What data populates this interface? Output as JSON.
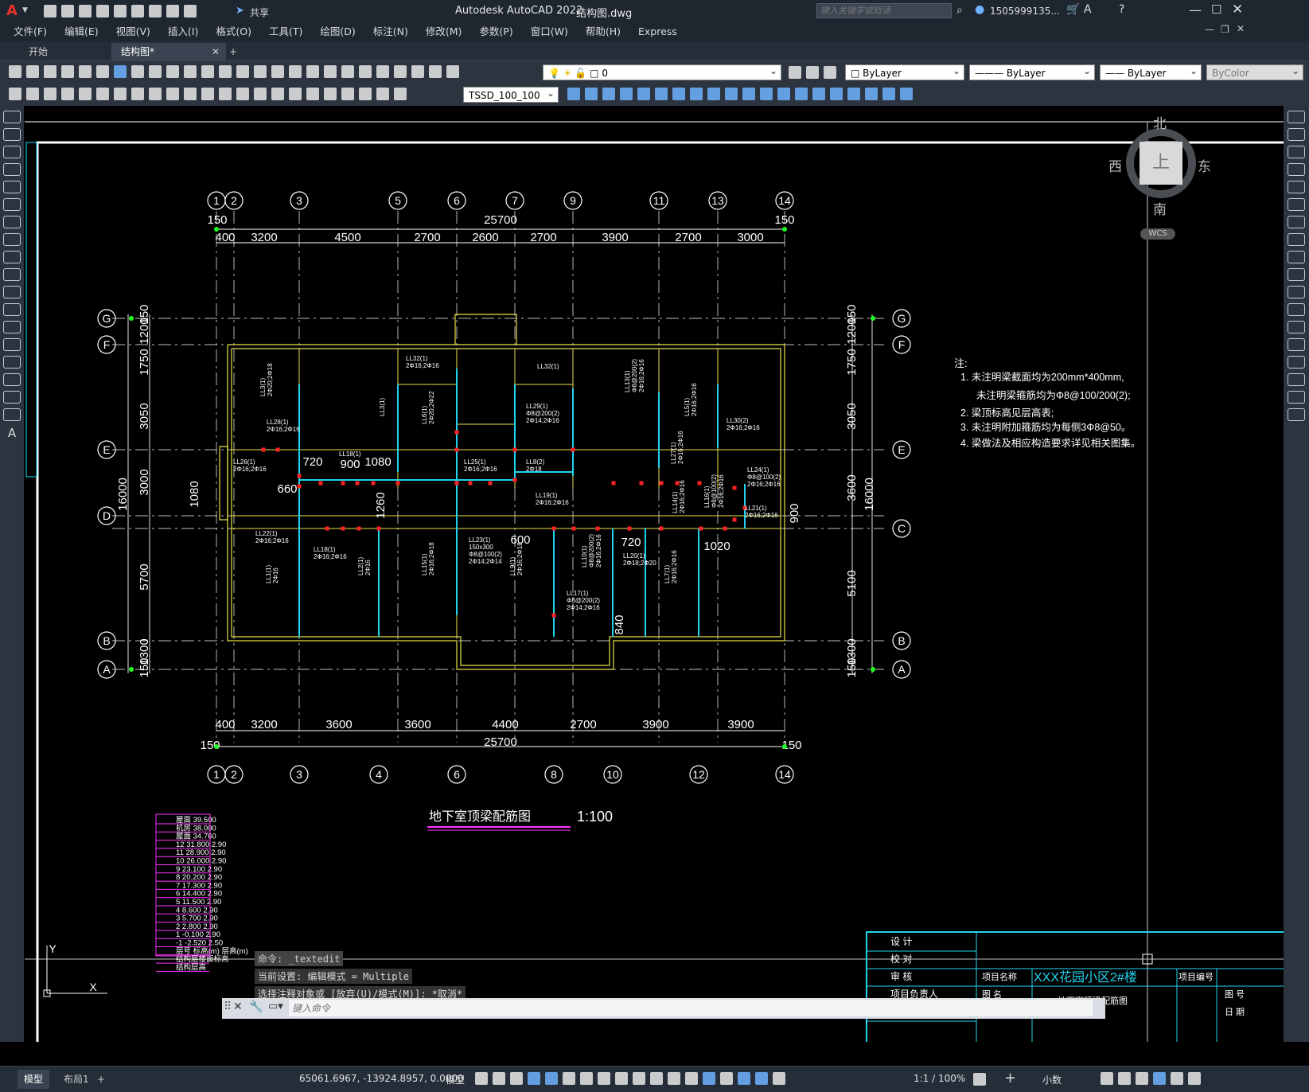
{
  "app": {
    "logo": "A",
    "title_app": "Autodesk AutoCAD 2022",
    "title_file": "结构图.dwg",
    "share": "共享",
    "search_placeholder": "键入关键字或短语",
    "user": "1505999135...",
    "window_controls": [
      "minimize-icon",
      "maximize-icon",
      "close-icon"
    ]
  },
  "menu": [
    "文件(F)",
    "编辑(E)",
    "视图(V)",
    "插入(I)",
    "格式(O)",
    "工具(T)",
    "绘图(D)",
    "标注(N)",
    "修改(M)",
    "参数(P)",
    "窗口(W)",
    "帮助(H)",
    "Express"
  ],
  "tabs": [
    {
      "label": "开始"
    },
    {
      "label": "结构图*"
    }
  ],
  "toolbar": {
    "layer_value": "0",
    "color_value": "ByLayer",
    "linetype_value": "ByLayer",
    "lineweight_value": "ByLayer",
    "plotstyle_value": "ByColor",
    "textstyle_value": "TSSD_100_100"
  },
  "viewcube": {
    "north": "北",
    "south": "南",
    "east": "东",
    "west": "西",
    "top": "上",
    "wcs": "WCS"
  },
  "drawing": {
    "top_axes": [
      "1",
      "2",
      "3",
      "5",
      "6",
      "7",
      "9",
      "11",
      "13",
      "14"
    ],
    "bottom_axes": [
      "1",
      "2",
      "3",
      "4",
      "6",
      "8",
      "10",
      "12",
      "14"
    ],
    "left_axes": [
      "G",
      "F",
      "E",
      "D",
      "B",
      "A"
    ],
    "right_axes": [
      "G",
      "F",
      "E",
      "C",
      "B",
      "A"
    ],
    "top_total": "25700",
    "top_edge": "150",
    "top_dims": [
      "400",
      "3200",
      "4500",
      "2700",
      "2600",
      "2700",
      "3900",
      "2700",
      "3000"
    ],
    "bottom_total": "25700",
    "bottom_edge": "150",
    "bottom_dims": [
      "400",
      "3200",
      "3600",
      "3600",
      "4400",
      "2700",
      "3900",
      "3900"
    ],
    "left_dims": [
      "150",
      "1200",
      "1750",
      "3050",
      "3000",
      "5700",
      "1300",
      "150"
    ],
    "left_total": "16000",
    "left_extra": "1080",
    "right_dims": [
      "150",
      "1200",
      "1750",
      "3050",
      "3600",
      "5100",
      "1300",
      "150"
    ],
    "right_total": "16000",
    "right_extra": "900",
    "inner_dims": [
      "720",
      "900",
      "1080",
      "660",
      "1260",
      "600",
      "720",
      "1020",
      "840",
      "900"
    ],
    "beam_labels": [
      "LL32(1)\n2Φ16;2Φ16",
      "LL32(1)",
      "LL3(1)\n2Φ20;2Φ18",
      "LL28(1)\n2Φ16;2Φ16",
      "LL3(1)",
      "LL6(1)\n2Φ20;2Φ22",
      "LL29(1)\nΦ8@200(2)\n2Φ14;2Φ16",
      "LL13(1)\nΦ8@200(2)\n2Φ16;2Φ16",
      "LL5(1)\n2Φ16;2Φ16",
      "LL30(2)\n2Φ16;2Φ16",
      "LL26(1)\n2Φ16;2Φ16",
      "LL18(1)",
      "LL25(1)\n2Φ16;2Φ16",
      "LL8(2)\n2Φ18",
      "LL27(1)\n2Φ16;2Φ16",
      "LL24(1)\nΦ8@100(2)\n2Φ16;2Φ16",
      "LL19(1)\n2Φ16;2Φ16",
      "LL14(1)\n2Φ16;2Φ16",
      "LL16(1)\nΦ8@100(2)\n2Φ16;2Φ16",
      "LL21(1)\n2Φ16;2Φ16",
      "LL22(1)\n2Φ16;2Φ16",
      "LL18(1)\n2Φ16;2Φ16",
      "LL23(1)\n150x300\nΦ8@100(2)\n2Φ14;2Φ14",
      "LL20(1)\n2Φ18;2Φ20",
      "LL2(1)\n2Φ16",
      "LL15(1)\n2Φ16;2Φ18",
      "LL9(1)\n2Φ16;2Φ18",
      "LL10(1)\nΦ8@200(2)\n2Φ16;2Φ16",
      "LL17(1)\nΦ8@200(2)\n2Φ14;2Φ16",
      "LL7(1)\n2Φ16;2Φ16",
      "LL1(1)\n2Φ16"
    ],
    "notes_title": "注:",
    "notes": [
      "1. 未注明梁截面均为200mm*400mm,",
      "未注明梁箍筋均为Φ8@100/200(2);",
      "2. 梁顶标高见层高表;",
      "3. 未注明附加箍筋均为每侧3Φ8@50。",
      "4. 梁做法及相应构造要求详见相关图集。"
    ],
    "drawing_title": "地下室顶梁配筋图",
    "scale": "1:100",
    "level_table": [
      "屋面  39.500",
      "机房  38.000",
      "屋面  34.760",
      "12  31.800  2.90",
      "11  28.900  2.90",
      "10  26.000  2.90",
      "9  23.100  2.90",
      "8  20.200  2.90",
      "7  17.300  2.90",
      "6  14.400  2.90",
      "5  11.500  2.90",
      "4  8.600  2.90",
      "3  5.700  2.90",
      "2  2.800  2.90",
      "1  -0.100  2.90",
      "-1  -2.520  2.50",
      "层号  标高(m)  层高(m)",
      "结构层楼面标高",
      "结构层高"
    ],
    "title_block": {
      "rows": [
        "设  计",
        "校  对",
        "审  核",
        "项目负责人",
        "专业负责人"
      ],
      "project_name_label": "项目名称",
      "project_name": "XXX花园小区2#楼",
      "project_no_label": "项目编号",
      "drawing_name_label": "图  名",
      "drawing_name": "地下室顶梁配筋图",
      "sheet_no_label": "图  号",
      "date_label": "日  期"
    },
    "ucs_x": "X",
    "ucs_y": "Y"
  },
  "command": {
    "history": [
      "命令: _textedit",
      "当前设置: 编辑模式 = Multiple",
      "选择注释对象或 [放弃(U)/模式(M)]: *取消*"
    ],
    "placeholder": "键入命令"
  },
  "layout_tabs": [
    "模型",
    "布局1"
  ],
  "status": {
    "coords": "65061.6967, -13924.8957, 0.0000",
    "space": "模型",
    "scale": "1:1 / 100%",
    "units": "小数"
  }
}
